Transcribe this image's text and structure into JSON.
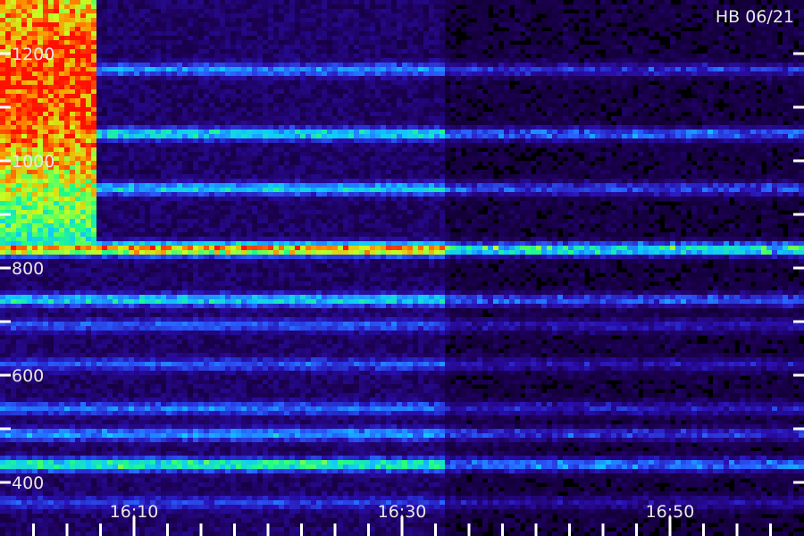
{
  "chart_data": {
    "type": "heatmap",
    "title": "",
    "station_label": "HB 06/21",
    "xlabel": "",
    "ylabel": "",
    "x_range_minutes": [
      16.0,
      17.0
    ],
    "x_tick_labels": [
      "16:10",
      "16:30",
      "16:50"
    ],
    "x_major_ticks": [
      16.1667,
      16.5,
      16.8333
    ],
    "x_minor_tick_step_minutes": 2.5,
    "y_range": [
      300,
      1300
    ],
    "y_tick_labels": [
      "1200",
      "1000",
      "800",
      "600",
      "400"
    ],
    "y_labeled_ticks": [
      1200,
      1000,
      800,
      600,
      400
    ],
    "y_tick_step": 100,
    "colormap": [
      "#000000",
      "#1c0052",
      "#2a0fb0",
      "#2860ff",
      "#10c8ff",
      "#20ff80",
      "#c8ff20",
      "#ff9000",
      "#ff1000"
    ],
    "harmonic_bands": [
      {
        "freq": 1170,
        "intensity": 0.3
      },
      {
        "freq": 1050,
        "intensity": 0.42
      },
      {
        "freq": 948,
        "intensity": 0.38
      },
      {
        "freq": 835,
        "intensity": 0.78
      },
      {
        "freq": 740,
        "intensity": 0.4
      },
      {
        "freq": 693,
        "intensity": 0.22
      },
      {
        "freq": 620,
        "intensity": 0.22
      },
      {
        "freq": 538,
        "intensity": 0.26
      },
      {
        "freq": 490,
        "intensity": 0.32
      },
      {
        "freq": 433,
        "intensity": 0.5
      },
      {
        "freq": 362,
        "intensity": 0.18
      }
    ],
    "events": [
      {
        "name": "burst",
        "t_start": 16.0,
        "t_end": 16.12,
        "f_low": 830,
        "f_high": 1300,
        "intensity": 1.0
      },
      {
        "name": "dropout",
        "t_start": 16.555,
        "t_end": 17.0,
        "intensity_factor": 0.55
      }
    ]
  }
}
